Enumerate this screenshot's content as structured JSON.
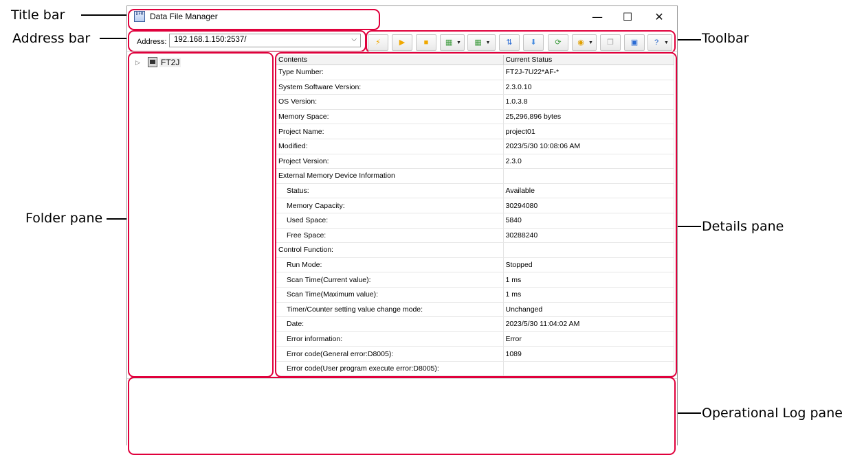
{
  "callouts": {
    "title_bar": "Title bar",
    "address_bar": "Address bar",
    "folder_pane": "Folder pane",
    "toolbar": "Toolbar",
    "details_pane": "Details pane",
    "operational_log_pane": "Operational Log pane"
  },
  "window": {
    "title": "Data File Manager",
    "app_icon_text": "DFM",
    "minimize_glyph": "—",
    "maximize_glyph": "☐",
    "close_glyph": "✕"
  },
  "address_bar": {
    "label": "Address:",
    "value": "192.168.1.150:2537/",
    "dropdown_glyph": "⌵"
  },
  "toolbar": {
    "buttons": [
      {
        "name": "flash-icon",
        "glyph": "⚡",
        "color": "#f0a800",
        "dropdown": false
      },
      {
        "name": "run-icon",
        "glyph": "▶",
        "color": "#f0a800",
        "dropdown": false
      },
      {
        "name": "stop-icon",
        "glyph": "■",
        "color": "#f0a800",
        "dropdown": false
      },
      {
        "name": "upload-icon",
        "glyph": "▦",
        "color": "#3c9a3c",
        "dropdown": true
      },
      {
        "name": "download-icon",
        "glyph": "▦",
        "color": "#3c9a3c",
        "dropdown": true
      },
      {
        "name": "transfer-icon",
        "glyph": "⇅",
        "color": "#2a6bd4",
        "dropdown": false
      },
      {
        "name": "import-icon",
        "glyph": "⬇",
        "color": "#4a8ee0",
        "dropdown": false
      },
      {
        "name": "refresh-icon",
        "glyph": "⟳",
        "color": "#3c9a3c",
        "dropdown": false
      },
      {
        "name": "memory-icon",
        "glyph": "◉",
        "color": "#e0a000",
        "dropdown": true
      },
      {
        "name": "copy-icon",
        "glyph": "❐",
        "color": "#a8a8a8",
        "dropdown": false
      },
      {
        "name": "export-icon",
        "glyph": "▣",
        "color": "#2a6bd4",
        "dropdown": false
      },
      {
        "name": "help-icon",
        "glyph": "?",
        "color": "#1e5fc8",
        "dropdown": true
      }
    ]
  },
  "folder_pane": {
    "expand_glyph": "▷",
    "tree_items": [
      {
        "label": "FT2J"
      }
    ]
  },
  "details": {
    "headers": [
      "Contents",
      "Current Status"
    ],
    "rows": [
      {
        "label": "Type Number:",
        "value": "FT2J-7U22*AF-*",
        "indent": false
      },
      {
        "label": "System Software Version:",
        "value": "2.3.0.10",
        "indent": false
      },
      {
        "label": "OS Version:",
        "value": "1.0.3.8",
        "indent": false
      },
      {
        "label": "Memory Space:",
        "value": "25,296,896 bytes",
        "indent": false
      },
      {
        "label": "Project Name:",
        "value": "project01",
        "indent": false
      },
      {
        "label": "Modified:",
        "value": "2023/5/30 10:08:06 AM",
        "indent": false
      },
      {
        "label": "Project Version:",
        "value": "2.3.0",
        "indent": false
      },
      {
        "label": "External Memory Device Information",
        "value": "",
        "indent": false
      },
      {
        "label": "Status:",
        "value": "Available",
        "indent": true
      },
      {
        "label": "Memory Capacity:",
        "value": "30294080",
        "indent": true
      },
      {
        "label": "Used Space:",
        "value": "5840",
        "indent": true
      },
      {
        "label": "Free Space:",
        "value": "30288240",
        "indent": true
      },
      {
        "label": "Control Function:",
        "value": "",
        "indent": false
      },
      {
        "label": "Run Mode:",
        "value": "Stopped",
        "indent": true
      },
      {
        "label": "Scan Time(Current value):",
        "value": "1 ms",
        "indent": true
      },
      {
        "label": "Scan Time(Maximum value):",
        "value": "1 ms",
        "indent": true
      },
      {
        "label": "Timer/Counter setting value change mode:",
        "value": "Unchanged",
        "indent": true
      },
      {
        "label": "Date:",
        "value": "2023/5/30 11:04:02 AM",
        "indent": true
      },
      {
        "label": "Error information:",
        "value": "Error",
        "indent": true
      },
      {
        "label": "Error code(General error:D8005):",
        "value": "1089",
        "indent": true
      },
      {
        "label": "Error code(User program execute error:D8005):",
        "value": "",
        "indent": true
      }
    ]
  },
  "colors": {
    "callout_frame": "#e0003c",
    "window_border": "#9a9a9a"
  }
}
